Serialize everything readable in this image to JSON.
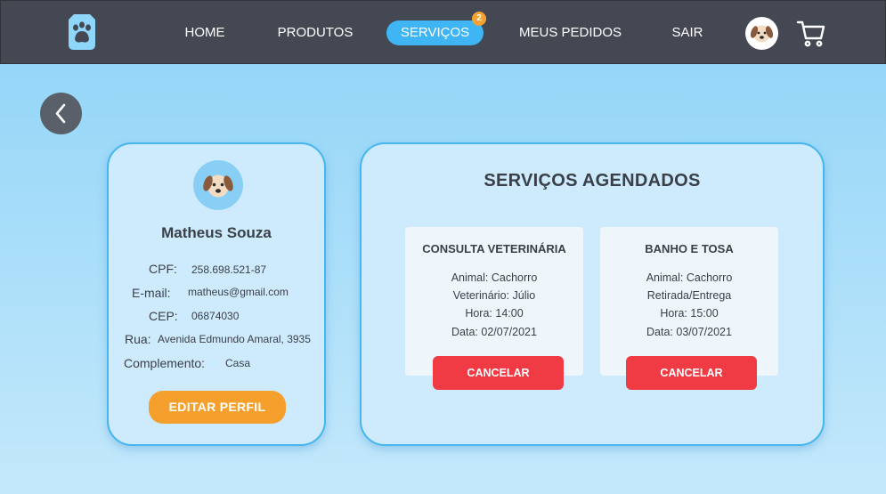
{
  "navbar": {
    "logo_icon": "paw-icon",
    "items": [
      {
        "label": "HOME"
      },
      {
        "label": "PRODUTOS"
      },
      {
        "label": "SERVIÇOS",
        "active": true,
        "badge": "2"
      },
      {
        "label": "MEUS PEDIDOS"
      },
      {
        "label": "SAIR"
      }
    ],
    "avatar_icon": "dog-avatar-icon",
    "cart_icon": "cart-icon"
  },
  "back_button": {
    "icon": "chevron-left-icon"
  },
  "profile": {
    "avatar_icon": "dog-avatar-icon",
    "name": "Matheus Souza",
    "fields": [
      {
        "label": "CPF:",
        "value": "258.698.521-87"
      },
      {
        "label": "E-mail:",
        "value": "matheus@gmail.com"
      },
      {
        "label": "CEP:",
        "value": "06874030"
      },
      {
        "label": "Rua:",
        "value": "Avenida Edmundo Amaral, 3935"
      },
      {
        "label": "Complemento:",
        "value": "Casa"
      }
    ],
    "edit_label": "EDITAR PERFIL"
  },
  "services": {
    "title": "SERVIÇOS AGENDADOS",
    "items": [
      {
        "name": "CONSULTA VETERINÁRIA",
        "lines": [
          "Animal: Cachorro",
          "Veterinário: Júlio",
          "Hora: 14:00",
          "Data: 02/07/2021"
        ],
        "cancel_label": "CANCELAR"
      },
      {
        "name": "BANHO E TOSA",
        "lines": [
          "Animal: Cachorro",
          "Retirada/Entrega",
          "Hora: 15:00",
          "Data: 03/07/2021"
        ],
        "cancel_label": "CANCELAR"
      }
    ]
  },
  "colors": {
    "navbar": "#434852",
    "active_tab": "#3fb5f3",
    "badge": "#f5a233",
    "edit_button": "#f5a02c",
    "cancel_button": "#f03a44",
    "card_border": "#47b5ee"
  }
}
